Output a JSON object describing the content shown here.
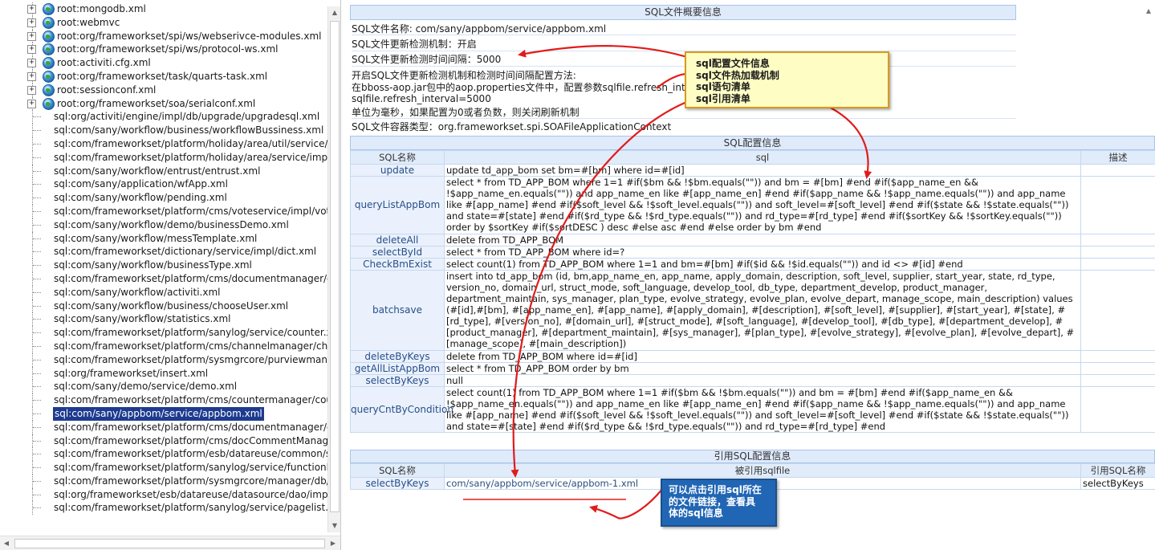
{
  "tree": {
    "items": [
      {
        "label": "root:mongodb.xml",
        "type": "root"
      },
      {
        "label": "root:webmvc",
        "type": "root"
      },
      {
        "label": "root:org/frameworkset/spi/ws/webserivce-modules.xml",
        "type": "root"
      },
      {
        "label": "root:org/frameworkset/spi/ws/protocol-ws.xml",
        "type": "root"
      },
      {
        "label": "root:activiti.cfg.xml",
        "type": "root"
      },
      {
        "label": "root:org/frameworkset/task/quarts-task.xml",
        "type": "root"
      },
      {
        "label": "root:sessionconf.xml",
        "type": "root"
      },
      {
        "label": "root:org/frameworkset/soa/serialconf.xml",
        "type": "root"
      },
      {
        "label": "sql:org/activiti/engine/impl/db/upgrade/upgradesql.xml",
        "type": "leaf"
      },
      {
        "label": "sql:com/sany/workflow/business/workflowBussiness.xml",
        "type": "leaf"
      },
      {
        "label": "sql:com/frameworkset/platform/holiday/area/util/service/impl/U",
        "type": "leaf"
      },
      {
        "label": "sql:com/frameworkset/platform/holiday/area/service/impl/Area",
        "type": "leaf"
      },
      {
        "label": "sql:com/sany/workflow/entrust/entrust.xml",
        "type": "leaf"
      },
      {
        "label": "sql:com/sany/application/wfApp.xml",
        "type": "leaf"
      },
      {
        "label": "sql:com/sany/workflow/pending.xml",
        "type": "leaf"
      },
      {
        "label": "sql:com/frameworkset/platform/cms/voteservice/impl/voteSer",
        "type": "leaf"
      },
      {
        "label": "sql:com/sany/workflow/demo/businessDemo.xml",
        "type": "leaf"
      },
      {
        "label": "sql:com/sany/workflow/messTemplate.xml",
        "type": "leaf"
      },
      {
        "label": "sql:com/frameworkset/dictionary/service/impl/dict.xml",
        "type": "leaf"
      },
      {
        "label": "sql:com/sany/workflow/businessType.xml",
        "type": "leaf"
      },
      {
        "label": "sql:com/frameworkset/platform/cms/documentmanager/doccl",
        "type": "leaf"
      },
      {
        "label": "sql:com/sany/workflow/activiti.xml",
        "type": "leaf"
      },
      {
        "label": "sql:com/sany/workflow/business/chooseUser.xml",
        "type": "leaf"
      },
      {
        "label": "sql:com/sany/workflow/statistics.xml",
        "type": "leaf"
      },
      {
        "label": "sql:com/frameworkset/platform/sanylog/service/counter.xml",
        "type": "leaf"
      },
      {
        "label": "sql:com/frameworkset/platform/cms/channelmanager/channel",
        "type": "leaf"
      },
      {
        "label": "sql:com/frameworkset/platform/sysmgrcore/purviewmanager/",
        "type": "leaf"
      },
      {
        "label": "sql:org/frameworkset/insert.xml",
        "type": "leaf"
      },
      {
        "label": "sql:com/sany/demo/service/demo.xml",
        "type": "leaf"
      },
      {
        "label": "sql:com/frameworkset/platform/cms/countermanager/counter",
        "type": "leaf"
      },
      {
        "label": "sql:com/sany/appbom/service/appbom.xml",
        "type": "leaf",
        "selected": true
      },
      {
        "label": "sql:com/frameworkset/platform/cms/documentmanager/docu",
        "type": "leaf"
      },
      {
        "label": "sql:com/frameworkset/platform/cms/docCommentManager/co",
        "type": "leaf"
      },
      {
        "label": "sql:com/frameworkset/platform/esb/datareuse/common/servic",
        "type": "leaf"
      },
      {
        "label": "sql:com/frameworkset/platform/sanylog/service/functionlist.xn",
        "type": "leaf"
      },
      {
        "label": "sql:com/frameworkset/platform/sysmgrcore/manager/db/resM",
        "type": "leaf"
      },
      {
        "label": "sql:org/frameworkset/esb/datareuse/datasource/dao/impl/dat",
        "type": "leaf"
      },
      {
        "label": "sql:com/frameworkset/platform/sanylog/service/pagelist.xml",
        "type": "leaf"
      }
    ]
  },
  "summary": {
    "header": "SQL文件概要信息",
    "file_name": "SQL文件名称:  com/sany/appbom/service/appbom.xml",
    "reload_mechanism": "SQL文件更新检测机制：开启",
    "reload_interval": "SQL文件更新检测时间间隔：5000",
    "config_line1": "开启SQL文件更新检测机制和检测时间间隔配置方法:",
    "config_line2": "在bboss-aop.jar包中的aop.properties文件中，配置参数sqlfile.refresh_interval",
    "config_line3": "sqlfile.refresh_interval=5000",
    "config_line4": "单位为毫秒，如果配置为0或者负数，则关闭刷新机制",
    "container_type": "SQL文件容器类型：org.frameworkset.spi.SOAFileApplicationContext"
  },
  "sql_config": {
    "header": "SQL配置信息",
    "columns": [
      "SQL名称",
      "sql",
      "描述"
    ],
    "rows": [
      {
        "name": "update",
        "sql": "update td_app_bom set bm=#[bm] where id=#[id]"
      },
      {
        "name": "queryListAppBom",
        "sql": "select * from TD_APP_BOM where 1=1 #if($bm && !$bm.equals(\"\")) and bm = #[bm] #end #if($app_name_en && !$app_name_en.equals(\"\")) and app_name_en like #[app_name_en] #end #if($app_name && !$app_name.equals(\"\")) and app_name like #[app_name] #end #if($soft_level && !$soft_level.equals(\"\")) and soft_level=#[soft_level] #end #if($state && !$state.equals(\"\")) and state=#[state] #end #if($rd_type && !$rd_type.equals(\"\")) and rd_type=#[rd_type] #end #if($sortKey && !$sortKey.equals(\"\")) order by $sortKey #if($sortDESC ) desc #else asc #end #else order by bm #end"
      },
      {
        "name": "deleteAll",
        "sql": "delete from TD_APP_BOM"
      },
      {
        "name": "selectById",
        "sql": "select * from TD_APP_BOM where id=?"
      },
      {
        "name": "CheckBmExist",
        "sql": "select count(1) from TD_APP_BOM where 1=1 and bm=#[bm] #if($id && !$id.equals(\"\")) and id <> #[id] #end"
      },
      {
        "name": "batchsave",
        "sql": "insert into td_app_bom (id, bm,app_name_en, app_name, apply_domain, description, soft_level, supplier, start_year, state, rd_type, version_no, domain_url, struct_mode, soft_language, develop_tool, db_type, department_develop, product_manager, department_maintain, sys_manager, plan_type, evolve_strategy, evolve_plan, evolve_depart, manage_scope, main_description) values (#[id],#[bm], #[app_name_en], #[app_name], #[apply_domain], #[description], #[soft_level], #[supplier], #[start_year], #[state], #[rd_type], #[version_no], #[domain_url], #[struct_mode], #[soft_language], #[develop_tool], #[db_type], #[department_develop], #[product_manager], #[department_maintain], #[sys_manager], #[plan_type], #[evolve_strategy], #[evolve_plan], #[evolve_depart], #[manage_scope], #[main_description])"
      },
      {
        "name": "deleteByKeys",
        "sql": "delete from TD_APP_BOM where id=#[id]"
      },
      {
        "name": "getAllListAppBom",
        "sql": "select * from TD_APP_BOM order by bm"
      },
      {
        "name": "selectByKeys",
        "sql": "null"
      },
      {
        "name": "queryCntByCondition",
        "sql": "select count(1) from TD_APP_BOM where 1=1 #if($bm && !$bm.equals(\"\")) and bm = #[bm] #end #if($app_name_en && !$app_name_en.equals(\"\")) and app_name_en like #[app_name_en] #end #if($app_name && !$app_name.equals(\"\")) and app_name like #[app_name] #end #if($soft_level && !$soft_level.equals(\"\")) and soft_level=#[soft_level] #end #if($state && !$state.equals(\"\")) and state=#[state] #end #if($rd_type && !$rd_type.equals(\"\")) and rd_type=#[rd_type] #end"
      }
    ]
  },
  "ref_config": {
    "header": "引用SQL配置信息",
    "columns": [
      "SQL名称",
      "被引用sqlfile",
      "引用SQL名称"
    ],
    "rows": [
      {
        "name": "selectByKeys",
        "file": "com/sany/appbom/service/appbom-1.xml",
        "ref_name": "selectByKeys"
      }
    ]
  },
  "callouts": {
    "main": [
      "sql配置文件信息",
      "sql文件热加载机制",
      "sql语句清单",
      "sql引用清单"
    ],
    "link": [
      "可以点击引用sql所在",
      "的文件链接，查看具",
      "体的sql信息"
    ]
  },
  "colors": {
    "header_bg": "#dfeafb",
    "selection": "#1e3b8f",
    "callout_yellow": "#fefdc4",
    "callout_blue": "#2166b4",
    "arrow_red": "#e11b1b"
  },
  "icons": {
    "expander": "+",
    "root_icon": "globe-icon",
    "scroll_up": "▲",
    "scroll_down": "▼",
    "scroll_left": "◀",
    "scroll_right": "▶"
  }
}
